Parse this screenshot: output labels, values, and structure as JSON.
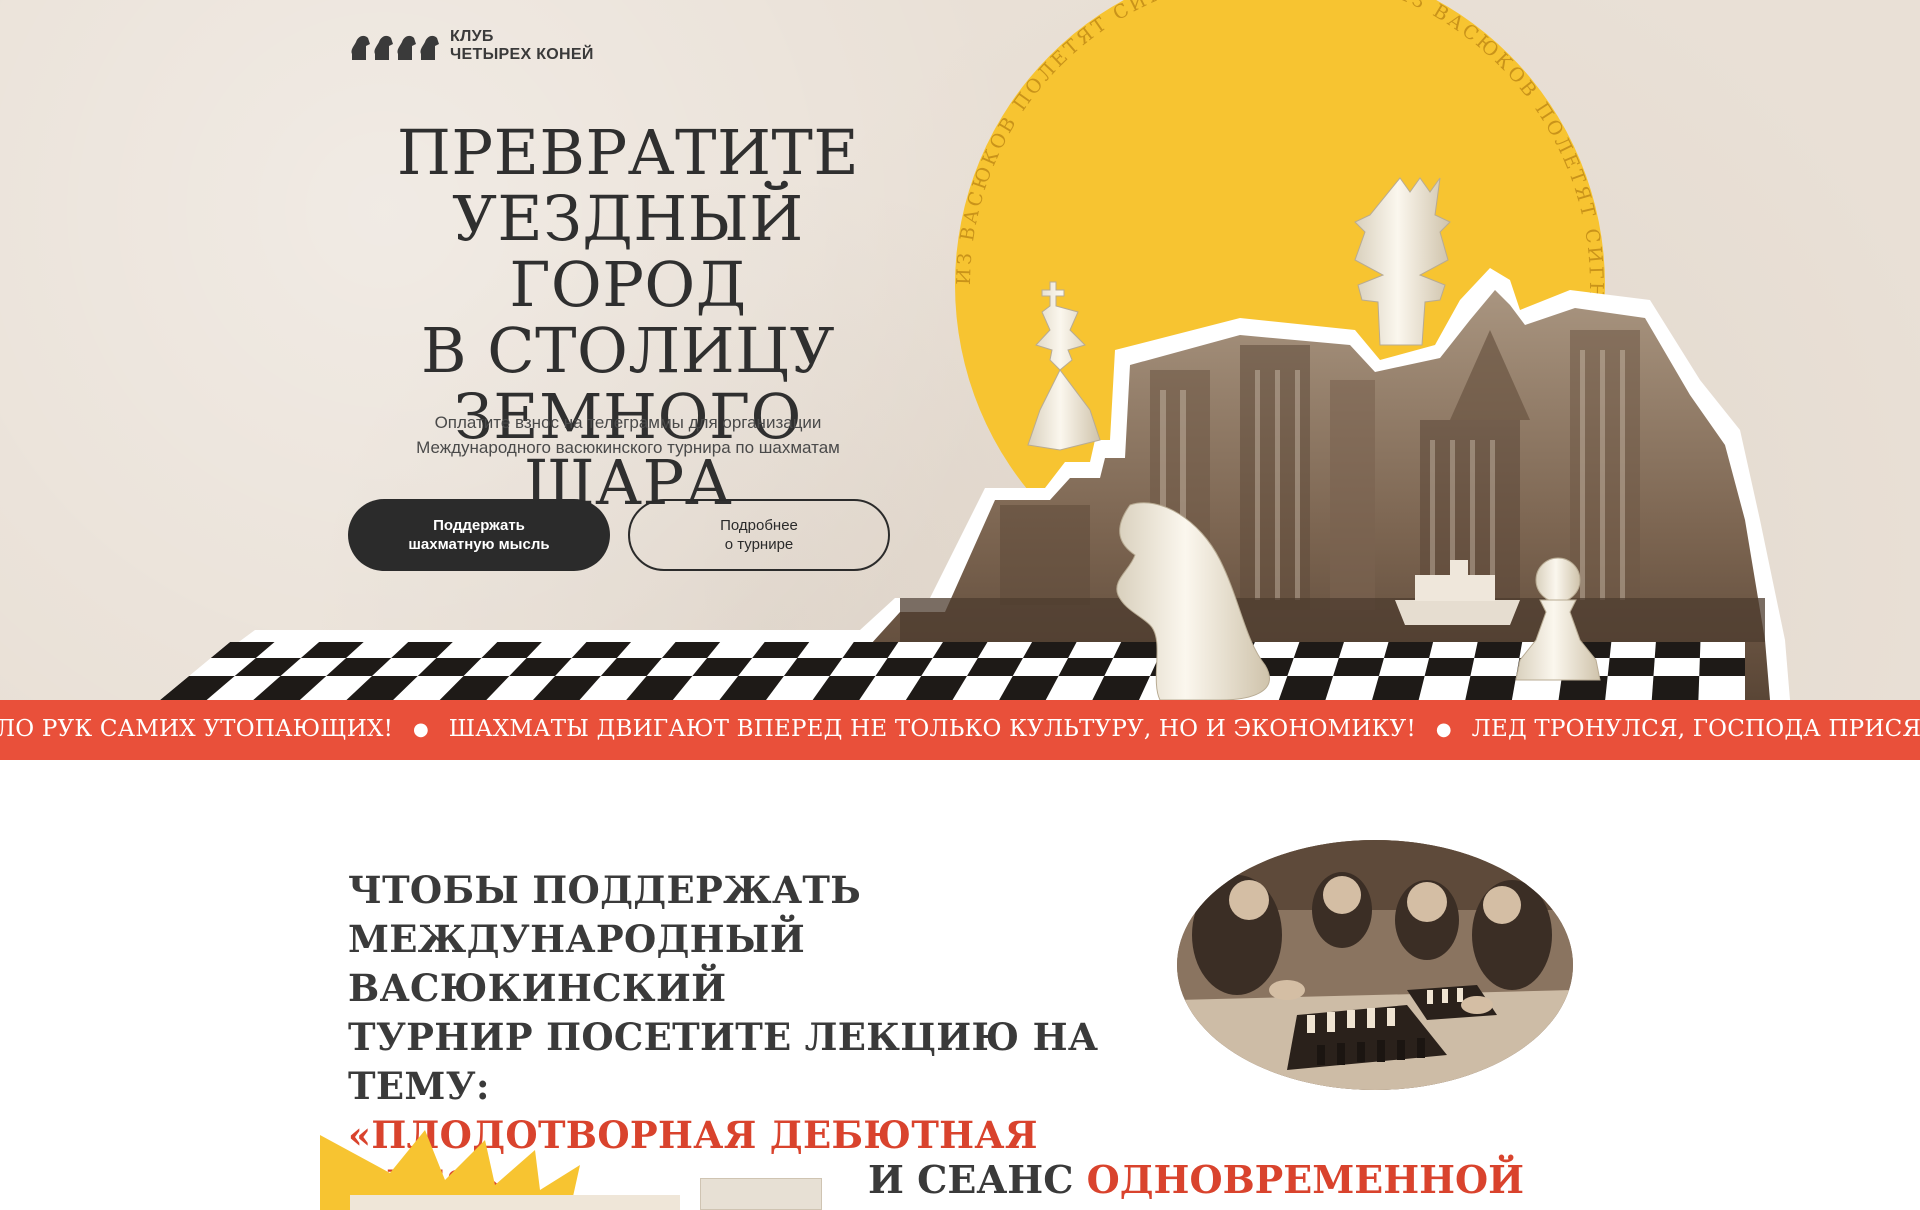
{
  "logo": {
    "line1": "КЛУБ",
    "line2": "ЧЕТЫРЕХ КОНЕЙ",
    "icon": "four-knights-icon"
  },
  "hero": {
    "title_lines": [
      "ПРЕВРАТИТЕ",
      "УЕЗДНЫЙ ГОРОД",
      "В СТОЛИЦУ",
      "ЗЕМНОГО ШАРА"
    ],
    "subtitle_lines": [
      "Оплатите взнос на телеграммы для организации",
      "Международного васюкинского турнира по шахматам"
    ],
    "primary_button": [
      "Поддержать",
      "шахматную мысль"
    ],
    "secondary_button": [
      "Подробнее",
      "о турнире"
    ],
    "circle_text": "ИЗ ВАСЮКОВ ПОЛЕТЯТ СИГНАЛЫ НА МАРС · ИЗ ВАСЮКОВ ПОЛЕТЯТ СИГНАЛЫ НА МАРС ·"
  },
  "ticker": {
    "items": [
      "ДЕЛО РУК САМИХ УТОПАЮЩИХ!",
      "ШАХМАТЫ ДВИГАЮТ ВПЕРЕД НЕ ТОЛЬКО КУЛЬТУРУ, НО И ЭКОНОМИКУ!",
      "ЛЕД ТРОНУЛСЯ, ГОСПОДА ПРИСЯЖНЫЕ ЗАСЕДАТЕЛИ!"
    ]
  },
  "lecture": {
    "lines": [
      "ЧТОБЫ ПОДДЕРЖАТЬ",
      "МЕЖДУНАРОДНЫЙ ВАСЮКИНСКИЙ",
      "ТУРНИР ПОСЕТИТЕ ЛЕКЦИЮ НА ТЕМУ:"
    ],
    "topic": "«ПЛОДОТВОРНАЯ ДЕБЮТНАЯ ИДЕЯ»"
  },
  "session": {
    "prefix": "И СЕАНС ",
    "accent": "ОДНОВРЕМЕННОЙ ИГРЫ"
  },
  "colors": {
    "accent": "#e9503a",
    "dark": "#2b2b2b",
    "sun": "#f7c431",
    "paper": "#e9e0d6"
  }
}
